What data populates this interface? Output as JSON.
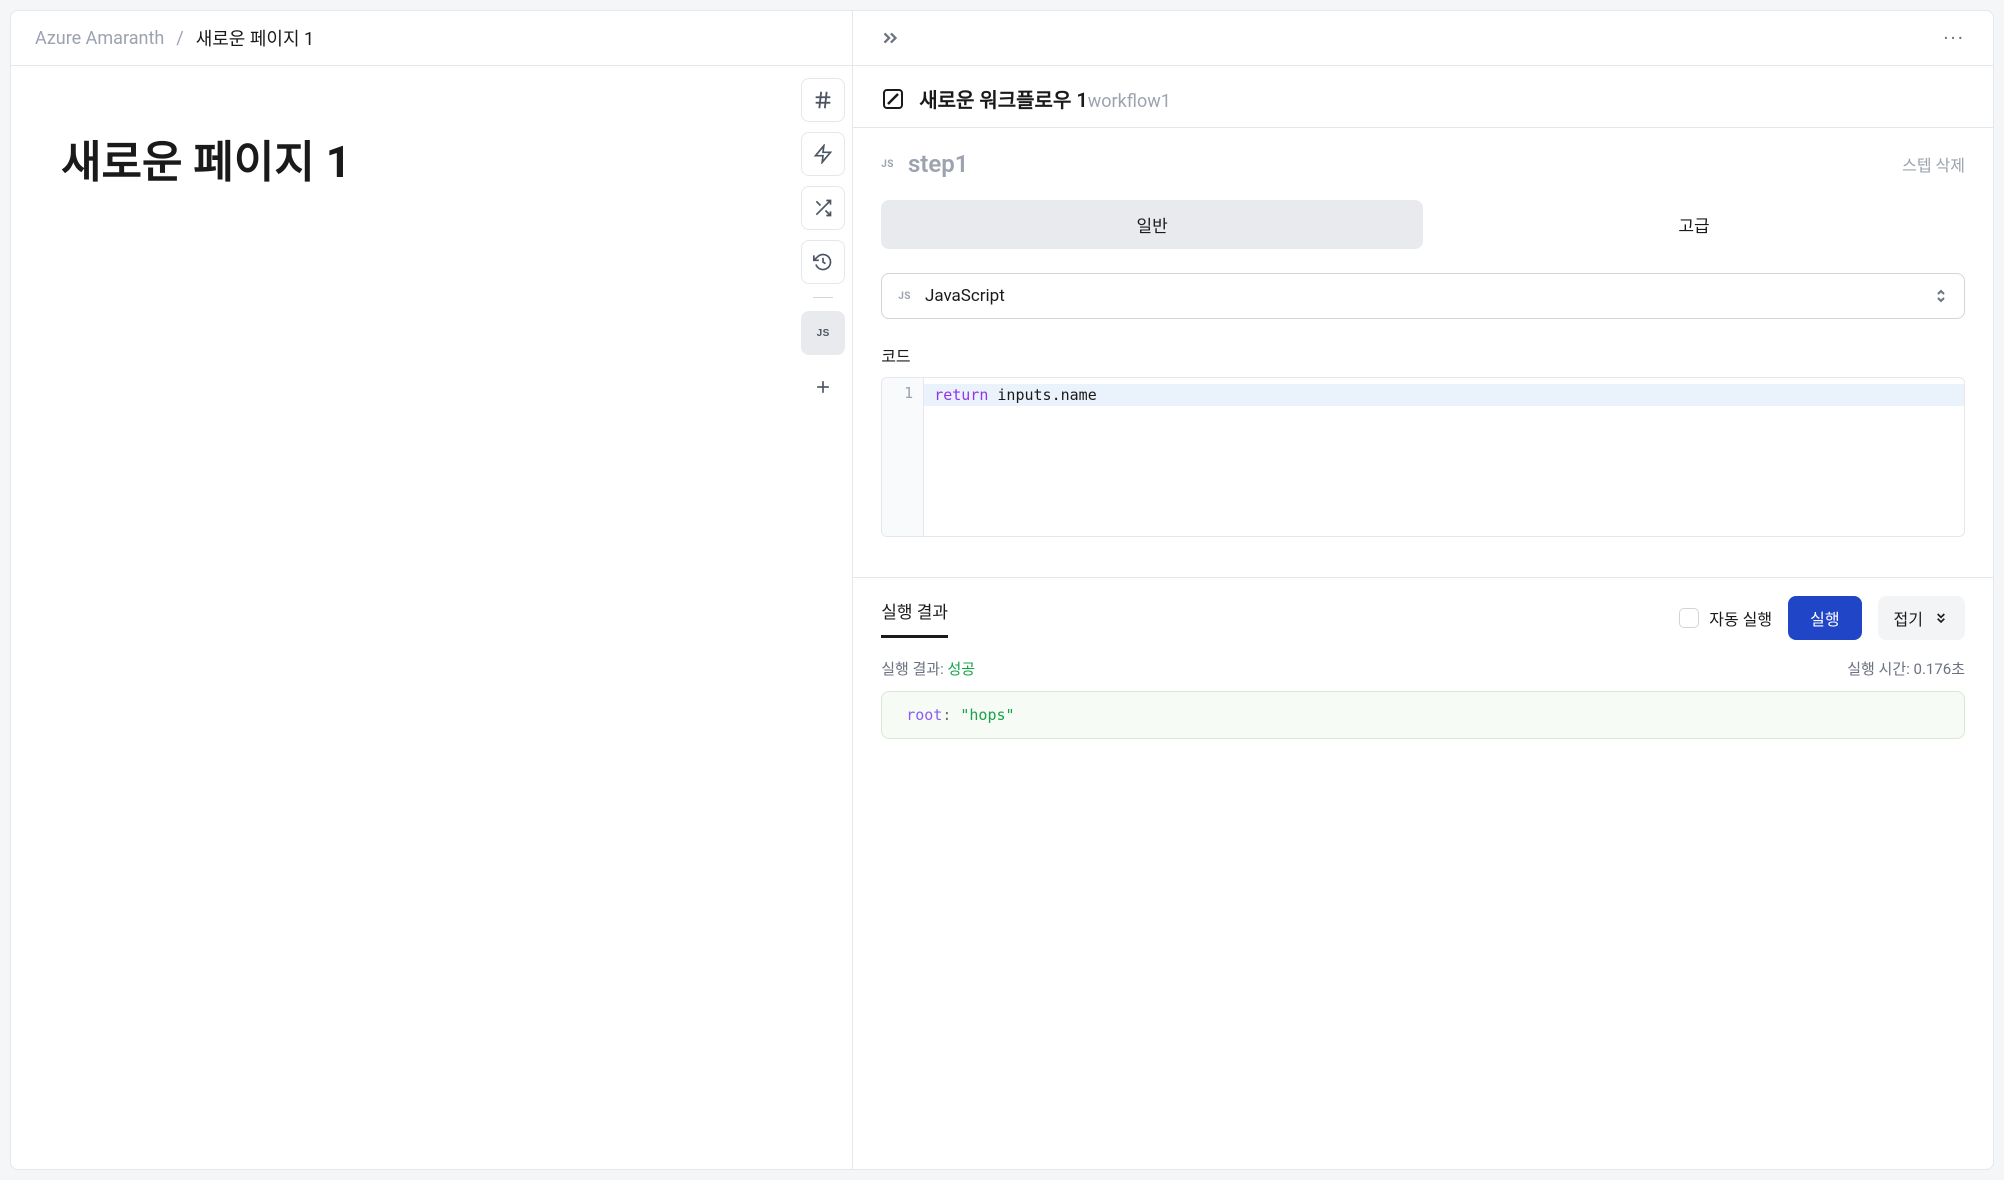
{
  "breadcrumb": {
    "workspace": "Azure Amaranth",
    "current": "새로운 페이지 1"
  },
  "page": {
    "title": "새로운 페이지 1"
  },
  "toolbar": {
    "js_badge": "JS"
  },
  "workflow": {
    "title": "새로운 워크플로우 1",
    "id": "workflow1"
  },
  "step": {
    "badge": "JS",
    "name": "step1",
    "delete_label": "스텝 삭제"
  },
  "tabs": {
    "general": "일반",
    "advanced": "고급"
  },
  "lang": {
    "badge": "JS",
    "name": "JavaScript"
  },
  "code": {
    "label": "코드",
    "line_number": "1",
    "keyword": "return",
    "rest": " inputs.name"
  },
  "result": {
    "tab_label": "실행 결과",
    "auto_run": "자동 실행",
    "run_label": "실행",
    "collapse_label": "접기",
    "status_prefix": "실행 결과: ",
    "status": "성공",
    "time_prefix": "실행 시간: ",
    "time": "0.176초",
    "json_key": "root",
    "json_value": "\"hops\""
  }
}
